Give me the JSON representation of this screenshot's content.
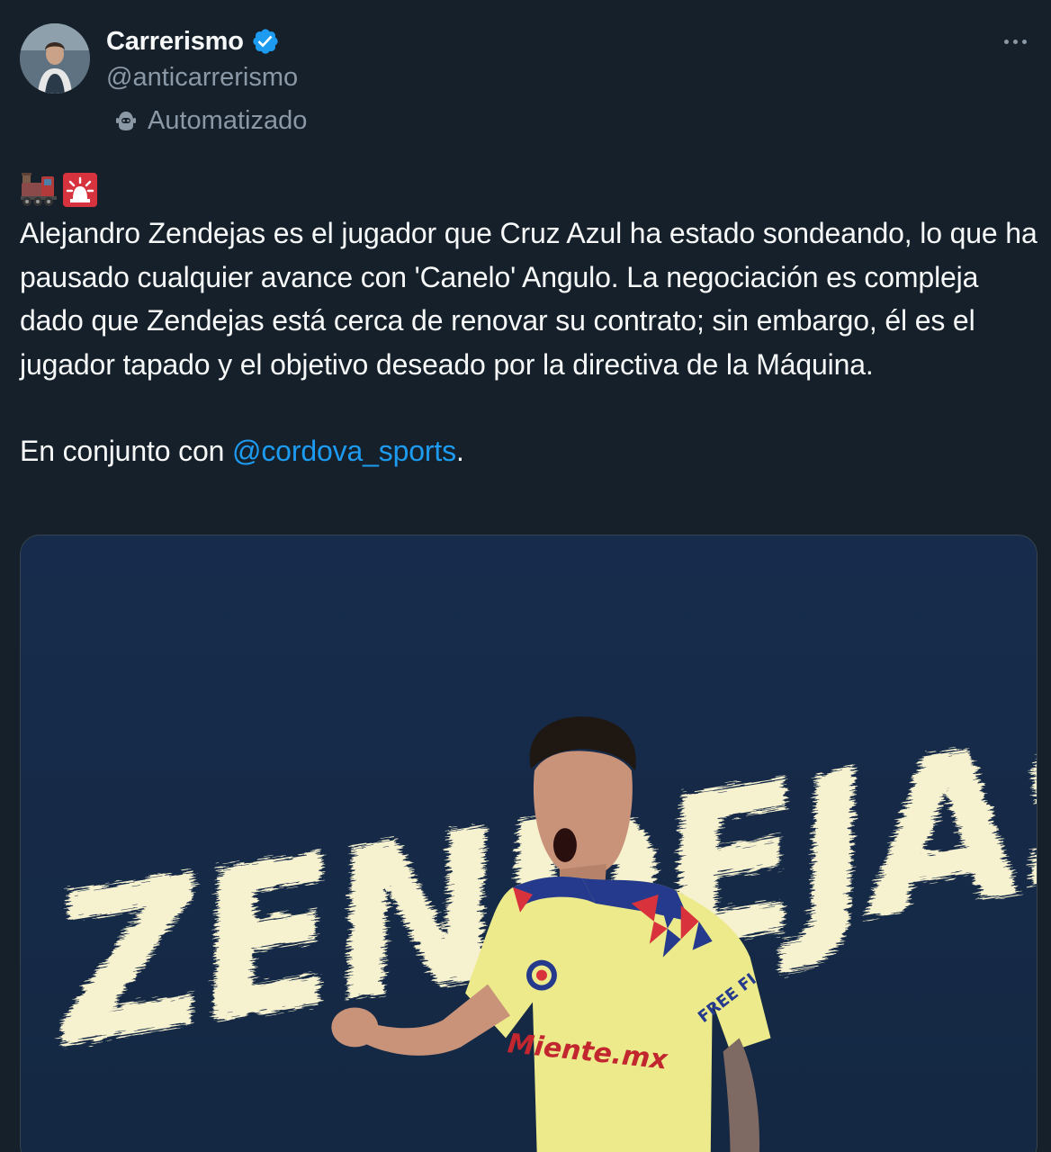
{
  "author": {
    "display_name": "Carrerismo",
    "handle": "@anticarrerismo",
    "automated_label": "Automatizado",
    "verified": true
  },
  "icons": {
    "verified": "verified-badge-icon",
    "automated": "bot-icon",
    "more": "more-options-icon",
    "emojis": [
      "steam-locomotive-emoji",
      "police-light-emoji"
    ]
  },
  "tweet": {
    "paragraph_1": "Alejandro Zendejas es el jugador que Cruz Azul ha estado sondeando, lo que ha pausado cualquier avance con 'Canelo' Angulo. La negociación es compleja dado que Zendejas está cerca de renovar su contrato; sin embargo, él es el jugador tapado y el objetivo deseado por la directiva de la Máquina.",
    "paragraph_2_prefix": "En conjunto con ",
    "paragraph_2_mention": "@cordova_sports",
    "paragraph_2_suffix": "."
  },
  "media": {
    "headline": "ZENDEJAS",
    "jersey_text": "Miente.mx",
    "sponsor_text": "FREE FI"
  },
  "colors": {
    "background": "#15202b",
    "text": "#f7f9f9",
    "secondary": "#8b98a5",
    "accent": "#1d9bf0",
    "media_bg": "#162b4a",
    "headline": "#f6f1cf",
    "jersey": "#ecea8a"
  }
}
